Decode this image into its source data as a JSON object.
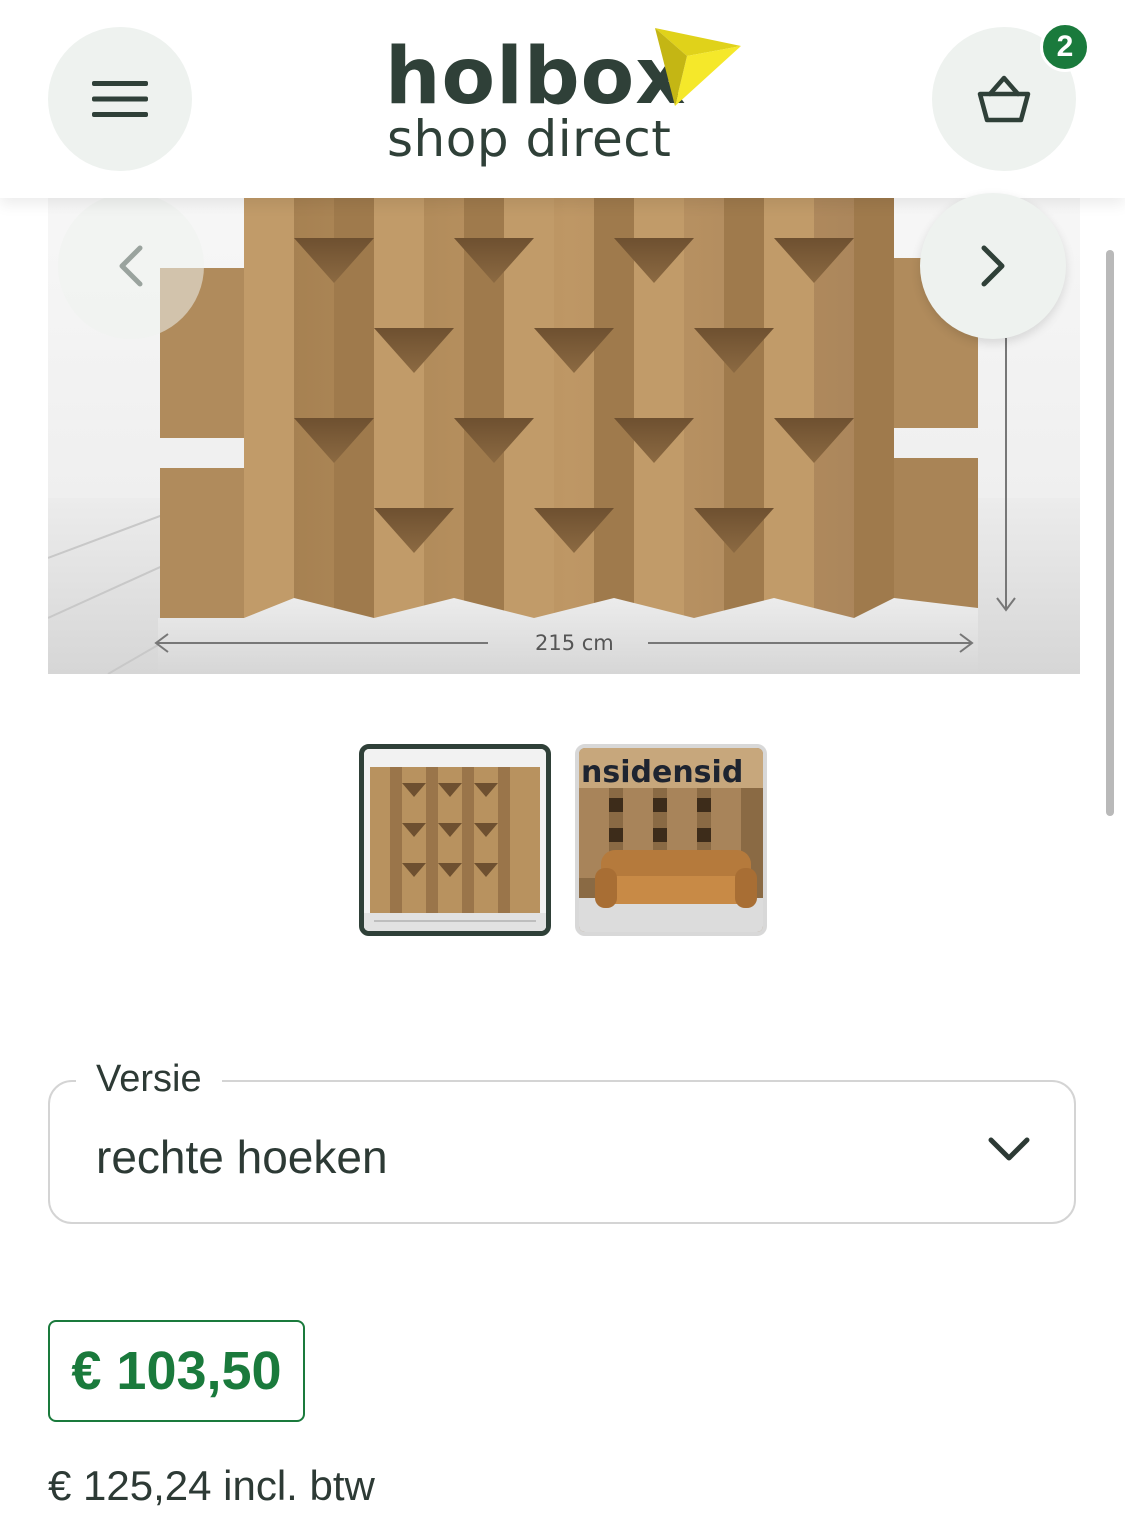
{
  "header": {
    "logo_top": "holbox",
    "logo_bottom": "shop direct",
    "menu_icon": "hamburger-menu-icon",
    "cart_icon": "basket-icon",
    "cart_count": "2"
  },
  "gallery": {
    "dimension_label": "215 cm",
    "prev_icon": "chevron-left-icon",
    "next_icon": "chevron-right-icon",
    "thumbnails": [
      {
        "name": "cardboard-wall-front",
        "selected": true
      },
      {
        "name": "cardboard-wall-with-sofa",
        "selected": false,
        "overlay_text": "nsidensid"
      }
    ]
  },
  "variant": {
    "label": "Versie",
    "value": "rechte hoeken"
  },
  "pricing": {
    "price": "€ 103,50",
    "price_incl": "€ 125,24 incl. btw"
  },
  "colors": {
    "brand_dark": "#2f4038",
    "brand_green": "#1a7a3c",
    "logo_yellow": "#f2e21a",
    "cardboard": "#b58d5a"
  }
}
